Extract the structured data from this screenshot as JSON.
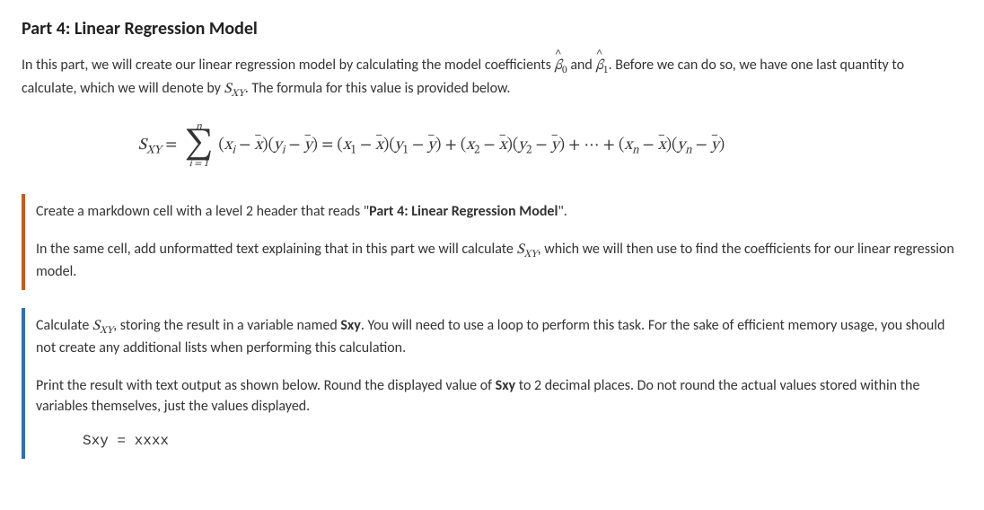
{
  "header": "Part 4: Linear Regression Model",
  "intro": {
    "t1": "In this part, we will create our linear regression model by calculating the model coefficients ",
    "beta0_base": "β",
    "beta0_sub": "0",
    "and": " and ",
    "beta1_base": "β",
    "beta1_sub": "1",
    "t2": ". Before we can do so, we have one last quantity to calculate, which we will denote by ",
    "sxy": "S",
    "sxy_sub": "XY",
    "t3": ". The formula for this value is provided below."
  },
  "formula": {
    "lhs": "S",
    "lhs_sub": "XY",
    "equals": "  =  ",
    "sigma_top": "n",
    "sigma_bot": "i = 1",
    "summand_open": "(",
    "xi": "x",
    "xi_sub": "i",
    "minus": " − ",
    "xbar": "x",
    "close": ")",
    "yi": "y",
    "yi_sub": "i",
    "ybar": "y",
    "eq2": "  =  ",
    "x1": "x",
    "sub1": "1",
    "y1": "y",
    "plus": " + ",
    "x2": "x",
    "sub2": "2",
    "y2": "y",
    "dots": " + ⋯ + ",
    "xn": "x",
    "subn": "n",
    "yn": "y"
  },
  "orange": {
    "p1a": "Create a markdown cell with a level 2 header that reads \"",
    "p1b": "Part 4: Linear Regression Model",
    "p1c": "\".",
    "p2a": "In the same cell, add unformatted text explaining that in this part we will calculate ",
    "p2_sxy": "S",
    "p2_sxy_sub": "XY",
    "p2b": ", which we will then use to find the coefficients for our linear regression model."
  },
  "blue": {
    "p1a": "Calculate ",
    "p1_sxy": "S",
    "p1_sxy_sub": "XY",
    "p1b": ", storing the result in a variable named ",
    "p1c": "Sxy",
    "p1d": ". You will need to use a loop to perform this task. For the sake of efficient memory usage, you should not create any additional lists when performing this calculation.",
    "p2a": "Print the result with text output as shown below. Round the displayed value of ",
    "p2b": "Sxy",
    "p2c": " to 2 decimal places. Do not round the actual values stored within the variables themselves, just the values displayed.",
    "code": "Sxy = xxxx"
  }
}
